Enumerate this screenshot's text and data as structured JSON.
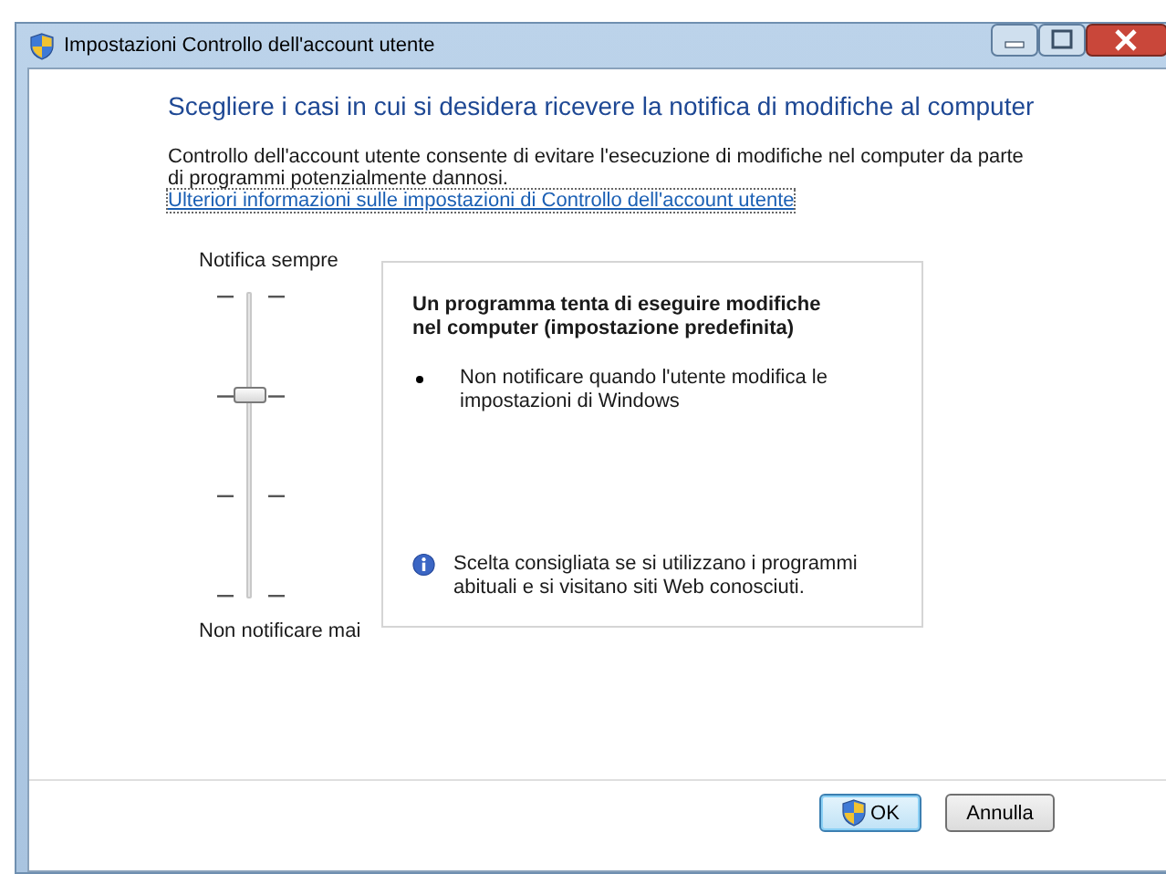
{
  "window": {
    "title": "Impostazioni Controllo dell'account utente"
  },
  "heading": "Scegliere i casi in cui si desidera ricevere la notifica di modifiche al computer",
  "description": "Controllo dell'account utente consente di evitare l'esecuzione di modifiche nel computer da parte di programmi potenzialmente dannosi.",
  "link": "Ulteriori informazioni sulle impostazioni di Controllo dell'account utente",
  "slider": {
    "top_label": "Notifica sempre",
    "bottom_label": "Non notificare mai",
    "level": 0.6667
  },
  "panel": {
    "title": "Un programma tenta di eseguire modifiche nel computer (impostazione predefinita)",
    "bullets": [
      "Non notificare quando l'utente modifica le impostazioni di Windows"
    ],
    "note": "Scelta consigliata se si utilizzano i programmi abituali e si visitano siti Web conosciuti."
  },
  "buttons": [
    {
      "label": "OK",
      "kind": "shield",
      "default": true
    },
    {
      "label": "Annulla",
      "kind": "plain",
      "default": false
    }
  ]
}
